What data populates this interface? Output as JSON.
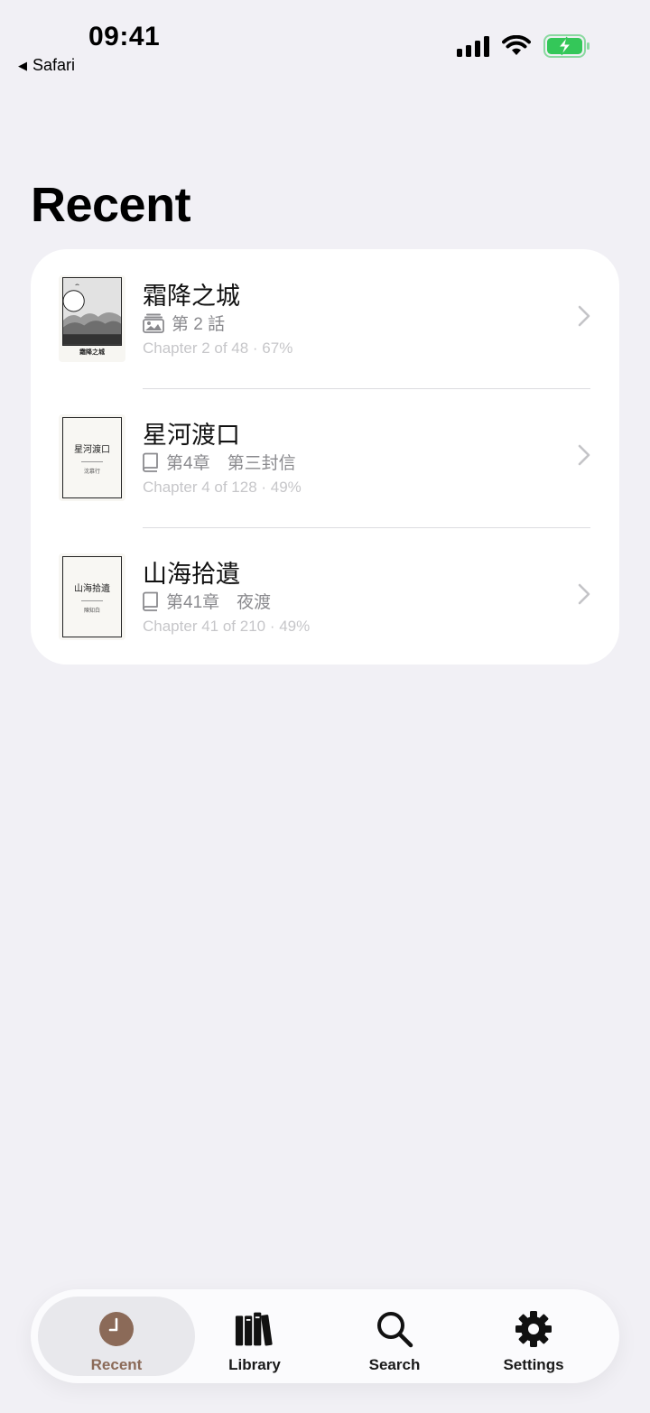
{
  "status_bar": {
    "time": "09:41",
    "back_app": "Safari",
    "battery_color": "#34c759"
  },
  "page": {
    "title": "Recent"
  },
  "recent_items": [
    {
      "title": "霜降之城",
      "chapter_icon": "image-stack-icon",
      "chapter": "第 2 話",
      "progress": "Chapter 2 of 48 · 67%",
      "cover_title": "霜降之城",
      "cover_type": "manga"
    },
    {
      "title": "星河渡口",
      "chapter_icon": "book-icon",
      "chapter": "第4章　第三封信",
      "progress": "Chapter 4 of 128 · 49%",
      "cover_title": "星河渡口",
      "cover_author": "沈慕行",
      "cover_type": "novel"
    },
    {
      "title": "山海拾遺",
      "chapter_icon": "book-icon",
      "chapter": "第41章　夜渡",
      "progress": "Chapter 41 of 210 · 49%",
      "cover_title": "山海拾遺",
      "cover_author": "陳知白",
      "cover_type": "novel"
    }
  ],
  "tab_bar": {
    "active_color": "#8b6a58",
    "tabs": [
      {
        "label": "Recent",
        "icon": "clock-icon",
        "active": true
      },
      {
        "label": "Library",
        "icon": "books-icon",
        "active": false
      },
      {
        "label": "Search",
        "icon": "magnifier-icon",
        "active": false
      },
      {
        "label": "Settings",
        "icon": "gear-icon",
        "active": false
      }
    ]
  }
}
